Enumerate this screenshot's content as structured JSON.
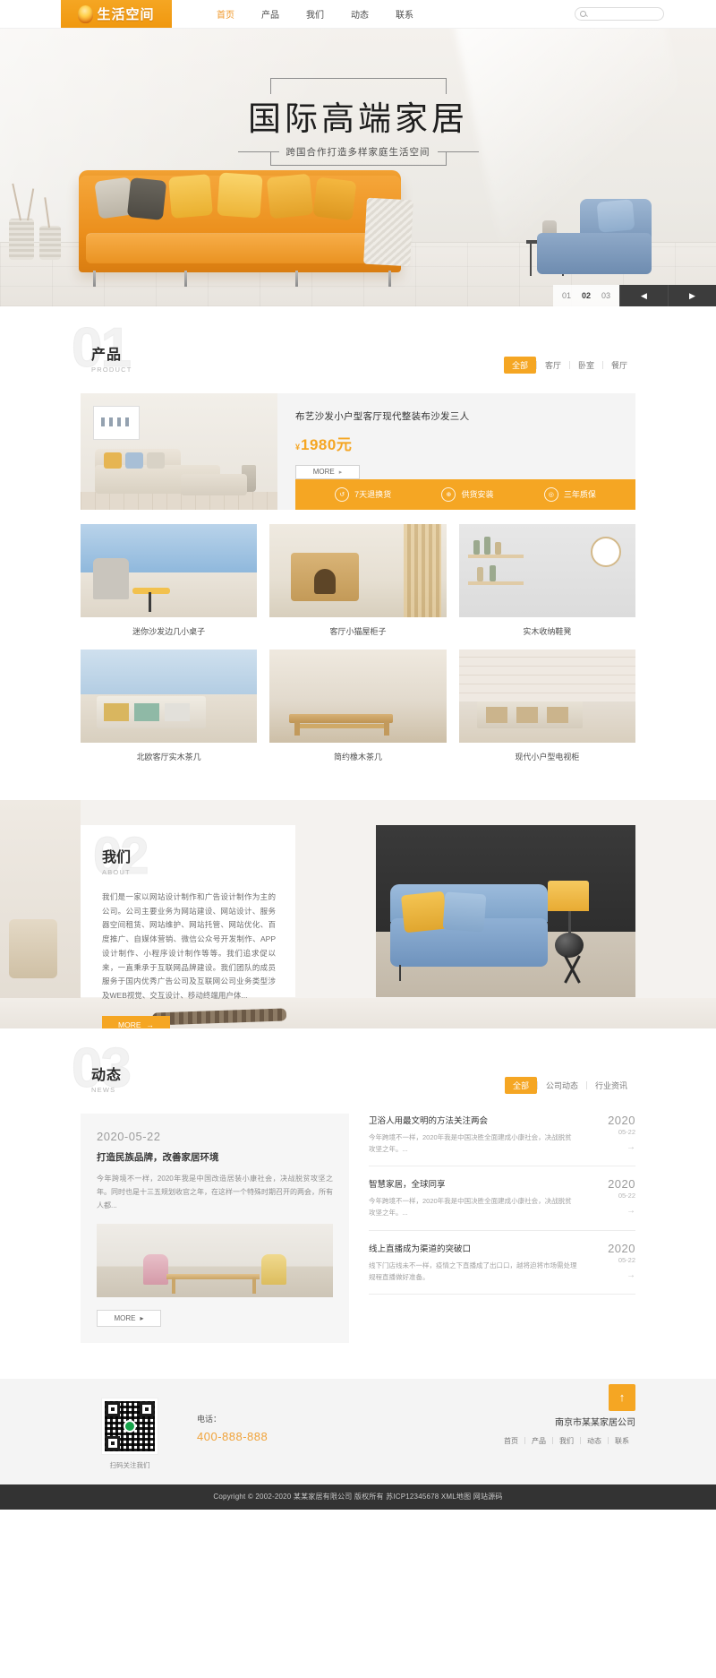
{
  "header": {
    "logo_text": "生活空间",
    "nav": [
      {
        "label": "首页",
        "active": true
      },
      {
        "label": "产品",
        "active": false
      },
      {
        "label": "我们",
        "active": false
      },
      {
        "label": "动态",
        "active": false
      },
      {
        "label": "联系",
        "active": false
      }
    ],
    "search_placeholder": "",
    "search_value": ""
  },
  "hero": {
    "title": "国际高端家居",
    "subtitle": "跨国合作打造多样家庭生活空间",
    "slides": [
      "01",
      "02",
      "03"
    ],
    "active_slide": "02",
    "prev_glyph": "◀",
    "next_glyph": "▶"
  },
  "product": {
    "number": "01",
    "title_cn": "产品",
    "title_en": "PRODUCT",
    "tabs": [
      {
        "label": "全部",
        "active": true
      },
      {
        "label": "客厅",
        "active": false
      },
      {
        "label": "卧室",
        "active": false
      },
      {
        "label": "餐厅",
        "active": false
      }
    ],
    "feature": {
      "title": "布艺沙发小户型客厅现代整装布沙发三人",
      "price_symbol": "¥",
      "price_value": "1980元",
      "more_label": "MORE",
      "more_arrow": "▸",
      "services": [
        {
          "icon": "refresh-icon",
          "glyph": "↺",
          "label": "7天退换货"
        },
        {
          "icon": "truck-icon",
          "glyph": "⊕",
          "label": "供货安装"
        },
        {
          "icon": "shield-icon",
          "glyph": "◎",
          "label": "三年质保"
        }
      ]
    },
    "grid": [
      {
        "caption": "迷你沙发边几小桌子"
      },
      {
        "caption": "客厅小猫屋柜子"
      },
      {
        "caption": "实木收纳鞋凳"
      },
      {
        "caption": "北欧客厅实木茶几"
      },
      {
        "caption": "简约橡木茶几"
      },
      {
        "caption": "现代小户型电视柜"
      }
    ]
  },
  "about": {
    "number": "02",
    "title_cn": "我们",
    "title_en": "ABOUT",
    "text": "我们是一家以网站设计制作和广告设计制作为主的公司。公司主要业务为网站建设、网站设计、服务器空间租赁、网站维护、网站托管、网站优化、百度推广、自媒体营销、微信公众号开发制作、APP设计制作、小程序设计制作等等。我们追求促以来，一直秉承于互联网品牌建设。我们团队的成员服务于国内优秀广告公司及互联网公司业务类型涉及WEB视觉、交互设计、移动终端用户体...",
    "more_label": "MORE",
    "more_arrow": "→"
  },
  "news": {
    "number": "03",
    "title_cn": "动态",
    "title_en": "NEWS",
    "tabs": [
      {
        "label": "全部",
        "active": true
      },
      {
        "label": "公司动态",
        "active": false
      },
      {
        "label": "行业资讯",
        "active": false
      }
    ],
    "featured": {
      "date": "2020-05-22",
      "title": "打造民族品牌，改善家居环境",
      "text": "今年跨境不一样，2020年我是中国改造居装小康社会，决战脱贫攻坚之年。同时也是十三五规划收官之年，在这样一个特殊时期召开的两会，所有人都...",
      "more_label": "MORE",
      "more_arrow": "▸"
    },
    "items": [
      {
        "title": "卫浴人用最文明的方法关注两会",
        "desc": "今年跨境不一样，2020年我是中国决胜全面建成小康社会，决战脱贫攻坚之年。...",
        "year": "2020",
        "md": "05-22",
        "arrow": "→"
      },
      {
        "title": "智慧家居，全球同享",
        "desc": "今年跨境不一样，2020年我是中国决胜全面建成小康社会，决战脱贫攻坚之年。...",
        "year": "2020",
        "md": "05-22",
        "arrow": "→"
      },
      {
        "title": "线上直播成为渠道的突破口",
        "desc": "线下门店线未不一样，疫情之下直播成了出口口，越将迫将市场需处理规程直播做好准备。",
        "year": "2020",
        "md": "05-22",
        "arrow": "→"
      }
    ]
  },
  "footer": {
    "qr_label": "扫码关注我们",
    "contact_label": "电话：",
    "phone": "400-888-888",
    "company": "南京市某某家居公司",
    "nav": [
      "首页",
      "产品",
      "我们",
      "动态",
      "联系"
    ],
    "backtop_glyph": "↑",
    "copyright": "Copyright © 2002-2020 某某家居有限公司 版权所有 苏ICP12345678 XML地图 网站源码"
  }
}
